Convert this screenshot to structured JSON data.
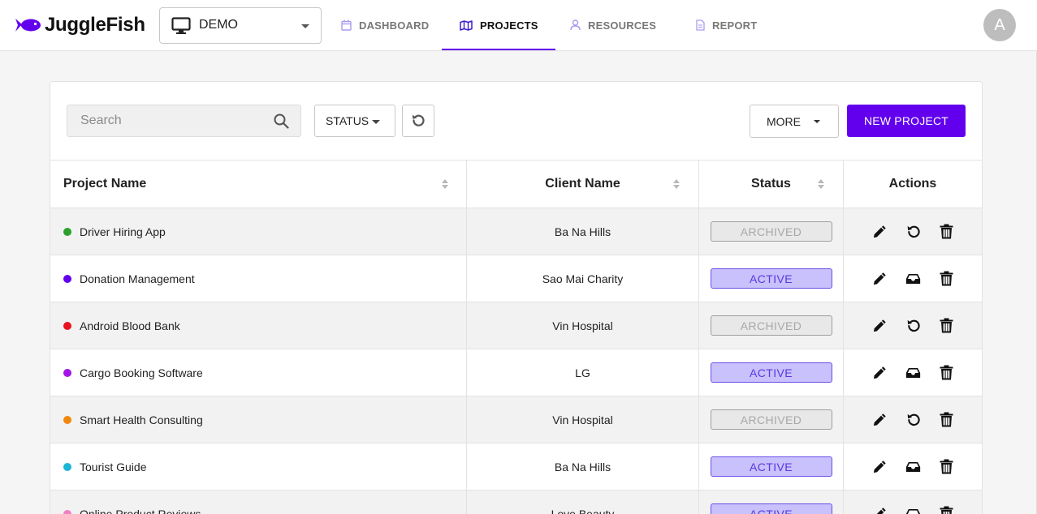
{
  "header": {
    "logo_text": "JuggleFish",
    "workspace": "DEMO",
    "nav": [
      {
        "label": "DASHBOARD",
        "icon": "calendar-icon",
        "active": false
      },
      {
        "label": "PROJECTS",
        "icon": "map-icon",
        "active": true
      },
      {
        "label": "RESOURCES",
        "icon": "person-icon",
        "active": false
      },
      {
        "label": "REPORT",
        "icon": "document-icon",
        "active": false
      }
    ],
    "avatar_initial": "A",
    "accent_color": "#6200ee"
  },
  "toolbar": {
    "search_placeholder": "Search",
    "status_label": "STATUS",
    "more_label": "MORE",
    "new_project_label": "NEW PROJECT"
  },
  "table": {
    "columns": [
      "Project Name",
      "Client Name",
      "Status",
      "Actions"
    ],
    "rows": [
      {
        "name": "Driver Hiring App",
        "client": "Ba Na Hills",
        "status": "ARCHIVED",
        "dot_color": "#2ca02c"
      },
      {
        "name": "Donation Management",
        "client": "Sao Mai Charity",
        "status": "ACTIVE",
        "dot_color": "#6200ee"
      },
      {
        "name": "Android Blood Bank",
        "client": "Vin Hospital",
        "status": "ARCHIVED",
        "dot_color": "#e8131f"
      },
      {
        "name": "Cargo Booking Software",
        "client": "LG",
        "status": "ACTIVE",
        "dot_color": "#a313e8"
      },
      {
        "name": "Smart Health Consulting",
        "client": "Vin Hospital",
        "status": "ARCHIVED",
        "dot_color": "#f2870e"
      },
      {
        "name": "Tourist Guide",
        "client": "Ba Na Hills",
        "status": "ACTIVE",
        "dot_color": "#1bb6d6"
      },
      {
        "name": "Online Product Reviews",
        "client": "Love Beauty",
        "status": "ACTIVE",
        "dot_color": "#f07fc4"
      }
    ]
  }
}
